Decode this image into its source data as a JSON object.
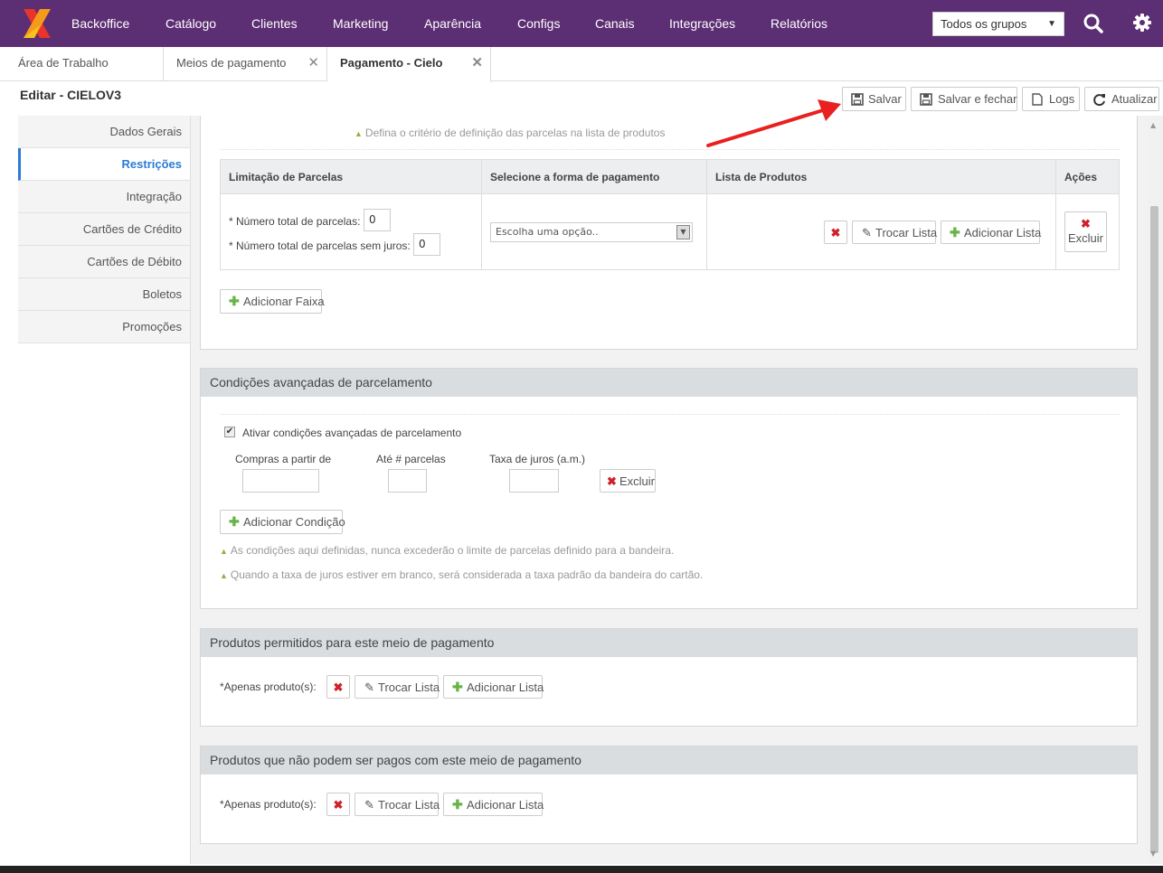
{
  "nav": {
    "items": [
      "Backoffice",
      "Catálogo",
      "Clientes",
      "Marketing",
      "Aparência",
      "Configs",
      "Canais",
      "Integrações",
      "Relatórios"
    ],
    "group_select": "Todos os grupos"
  },
  "tabs": [
    "Área de Trabalho",
    "Meios de pagamento",
    "Pagamento - Cielo"
  ],
  "page_title": "Editar - CIELOV3",
  "toolbar": {
    "save": "Salvar",
    "save_close": "Salvar e fechar",
    "logs": "Logs",
    "refresh": "Atualizar"
  },
  "sidebar": [
    "Dados Gerais",
    "Restrições",
    "Integração",
    "Cartões de Crédito",
    "Cartões de Débito",
    "Boletos",
    "Promoções"
  ],
  "parcelas": {
    "hint": "Defina o critério de definição das parcelas na lista de produtos",
    "headers": [
      "Limitação de Parcelas",
      "Selecione a forma de pagamento",
      "Lista de Produtos",
      "Ações"
    ],
    "total_label": "* Número total de parcelas:",
    "total_value": "0",
    "sem_juros_label": "* Número total de parcelas sem juros:",
    "sem_juros_value": "0",
    "select_placeholder": "Escolha uma opção..",
    "trocar": "Trocar Lista",
    "adicionar": "Adicionar Lista",
    "excluir": "Excluir",
    "add_faixa": "Adicionar Faixa"
  },
  "avancadas": {
    "title": "Condições avançadas de parcelamento",
    "checkbox_label": "Ativar condições avançadas de parcelamento",
    "col1": "Compras a partir de",
    "col2": "Até # parcelas",
    "col3": "Taxa de juros (a.m.)",
    "excluir": "Excluir",
    "add": "Adicionar Condição",
    "hint1": "As condições aqui definidas, nunca excederão o limite de parcelas definido para a bandeira.",
    "hint2": "Quando a taxa de juros estiver em branco, será considerada a taxa padrão da bandeira do cartão."
  },
  "permitidos": {
    "title": "Produtos permitidos para este meio de pagamento",
    "label": "*Apenas produto(s):",
    "trocar": "Trocar Lista",
    "adicionar": "Adicionar Lista"
  },
  "proibidos": {
    "title": "Produtos que não podem ser pagos com este meio de pagamento",
    "label": "*Apenas produto(s):",
    "trocar": "Trocar Lista",
    "adicionar": "Adicionar Lista"
  },
  "colors": {
    "nav_bg": "#5c2e73",
    "accent": "#2b7bd6",
    "danger": "#d0202a",
    "success": "#67b346"
  }
}
